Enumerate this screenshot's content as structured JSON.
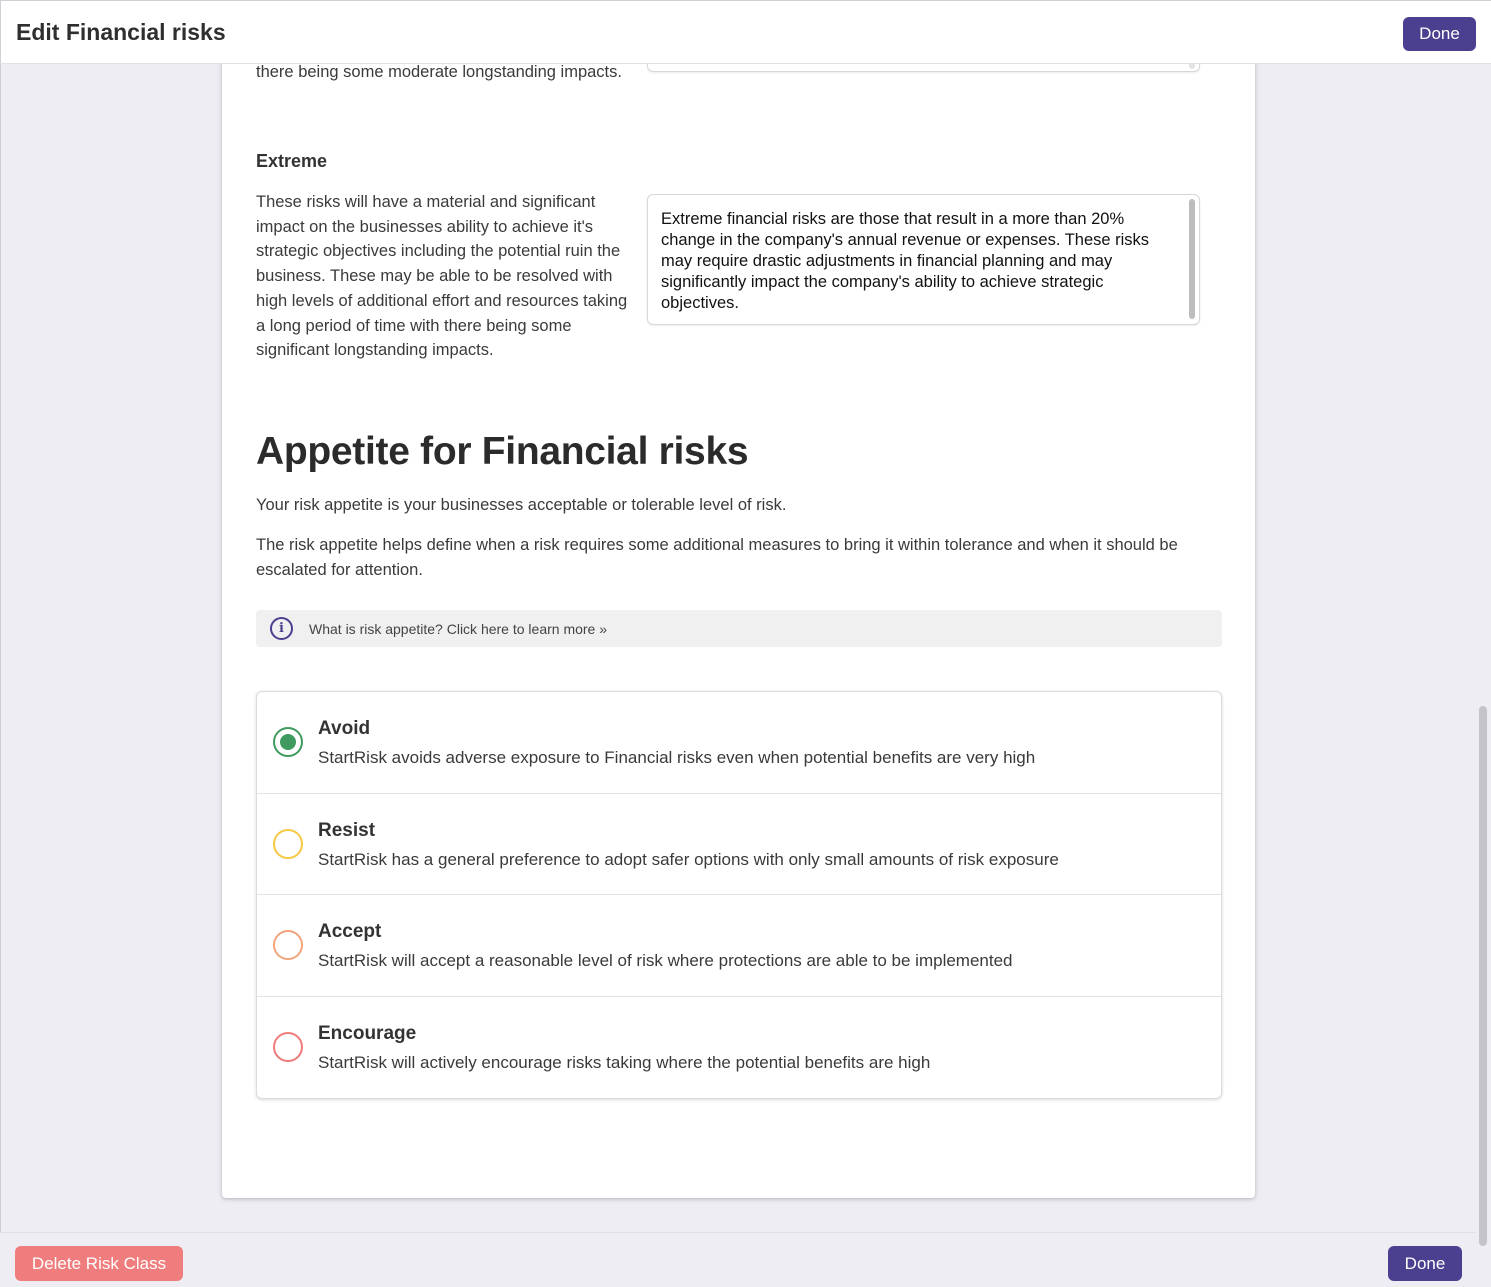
{
  "header": {
    "title": "Edit Financial risks",
    "done_label": "Done"
  },
  "major_level": {
    "description_tail": "there being some moderate longstanding impacts."
  },
  "extreme_level": {
    "title": "Extreme",
    "description": "These risks will have a material and significant impact on the businesses ability to achieve it's strategic objectives including the potential ruin the business. These may be able to be resolved with high levels of additional effort and resources taking a long period of time with there being some significant longstanding impacts.",
    "textbox_value": "Extreme financial risks are those that result in a more than 20% change in the company's annual revenue or expenses. These risks may require drastic adjustments in financial planning and may significantly impact the company's ability to achieve strategic objectives."
  },
  "appetite": {
    "title": "Appetite for Financial risks",
    "para1": "Your risk appetite is your businesses acceptable or tolerable level of risk.",
    "para2": "The risk appetite helps define when a risk requires some additional measures to bring it within tolerance and when it should be escalated for attention.",
    "info_link": "What is risk appetite? Click here to learn more »",
    "info_icon": "info-icon",
    "selected": "Avoid",
    "options": [
      {
        "title": "Avoid",
        "description": "StartRisk avoids adverse exposure to Financial risks even when potential benefits are very high",
        "color": "#3f9a5f",
        "selected": true
      },
      {
        "title": "Resist",
        "description": "StartRisk has a general preference to adopt safer options with only small amounts of risk exposure",
        "color": "#f5c842",
        "selected": false
      },
      {
        "title": "Accept",
        "description": "StartRisk will accept a reasonable level of risk where protections are able to be implemented",
        "color": "#f2a57a",
        "selected": false
      },
      {
        "title": "Encourage",
        "description": "StartRisk will actively encourage risks taking where the potential benefits are high",
        "color": "#ee7b7b",
        "selected": false
      }
    ]
  },
  "footer": {
    "delete_label": "Delete Risk Class",
    "done_label": "Done"
  },
  "colors": {
    "primary": "#4b3f8f",
    "danger": "#f07d7d"
  }
}
